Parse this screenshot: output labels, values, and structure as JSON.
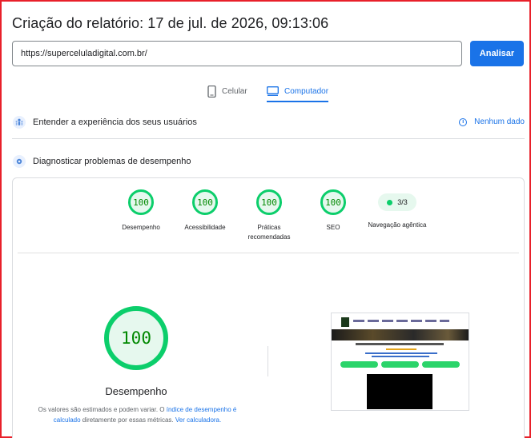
{
  "report": {
    "title": "Criação do relatório: 17 de jul. de 2026, 09:13:06"
  },
  "search": {
    "url_value": "https://superceluladigital.com.br/",
    "analyze_label": "Analisar"
  },
  "tabs": [
    {
      "label": "Celular",
      "icon": "smartphone-icon",
      "active": false
    },
    {
      "label": "Computador",
      "icon": "monitor-icon",
      "active": true
    }
  ],
  "ux_section": {
    "label": "Entender a experiência dos seus usuários",
    "icon": "users-icon",
    "no_data_label": "Nenhum dado"
  },
  "diag_section": {
    "label": "Diagnosticar problemas de desempenho",
    "icon": "lighthouse-icon"
  },
  "scores": [
    {
      "value": "100",
      "label": "Desempenho"
    },
    {
      "value": "100",
      "label": "Acessibilidade"
    },
    {
      "value": "100",
      "label": "Práticas recomendadas"
    },
    {
      "value": "100",
      "label": "SEO"
    }
  ],
  "agent_nav": {
    "value": "3/3",
    "label": "Navegação agêntica"
  },
  "performance": {
    "score": "100",
    "label": "Desempenho",
    "note_prefix": "Os valores são estimados e podem variar. O",
    "note_link1": "índice de desempenho é calculado",
    "note_middle": "diretamente por essas métricas.",
    "note_link2": "Ver calculadora."
  },
  "colors": {
    "accent": "#1a73e8",
    "pass_green": "#0cce6b",
    "pass_text": "#008800",
    "frame_red": "#e8202a"
  }
}
